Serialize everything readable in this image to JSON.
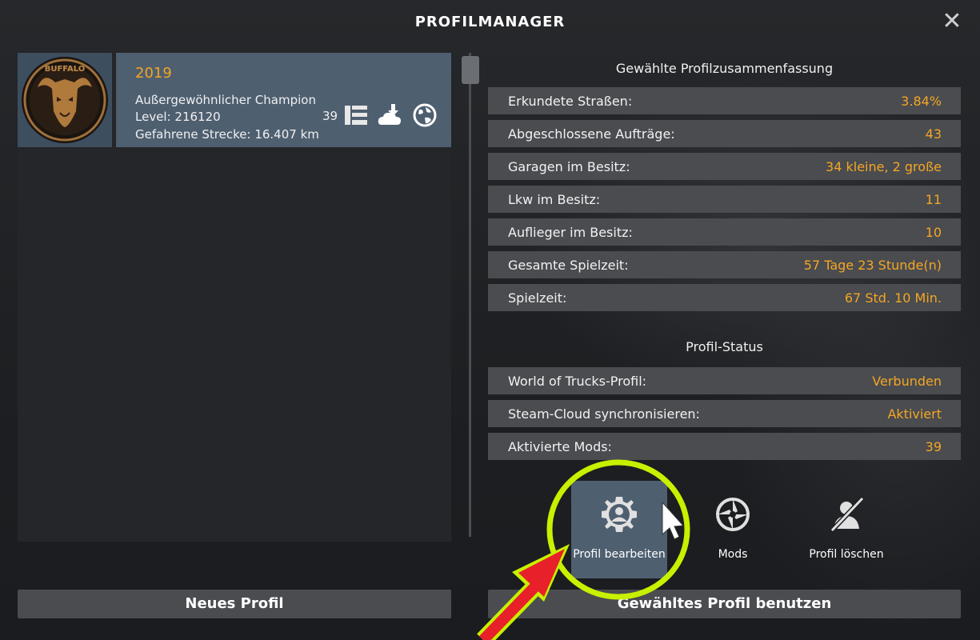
{
  "window": {
    "title": "PROFILMANAGER",
    "close_icon": "close-icon"
  },
  "profile": {
    "name": "2019",
    "title": "Außergewöhnlicher Champion",
    "level": "Level: 216120",
    "distance": "Gefahrene Strecke: 16.407 km",
    "mods_count": "39",
    "icons": [
      "mods-list-icon",
      "cloud-download-icon",
      "globe-icon"
    ],
    "avatar": {
      "text": "BUFFALO",
      "icon": "buffalo-skull-logo"
    }
  },
  "summary": {
    "title": "Gewählte Profilzusammenfassung",
    "rows": [
      {
        "label": "Erkundete Straßen:",
        "value": "3.84%"
      },
      {
        "label": "Abgeschlossene Aufträge:",
        "value": "43"
      },
      {
        "label": "Garagen im Besitz:",
        "value": "34 kleine, 2 große"
      },
      {
        "label": "Lkw im Besitz:",
        "value": "11"
      },
      {
        "label": "Auflieger im Besitz:",
        "value": "10"
      },
      {
        "label": "Gesamte Spielzeit:",
        "value": "57 Tage 23 Stunde(n)"
      },
      {
        "label": "Spielzeit:",
        "value": "67 Std. 10 Min."
      }
    ]
  },
  "status": {
    "title": "Profil-Status",
    "rows": [
      {
        "label": "World of Trucks-Profil:",
        "value": "Verbunden"
      },
      {
        "label": "Steam-Cloud synchronisieren:",
        "value": "Aktiviert"
      },
      {
        "label": "Aktivierte Mods:",
        "value": "39"
      }
    ]
  },
  "actions": [
    {
      "label": "Profil bearbeiten",
      "icon": "gear-person-icon"
    },
    {
      "label": "Mods",
      "icon": "mods-icon"
    },
    {
      "label": "Profil löschen",
      "icon": "delete-profile-icon"
    }
  ],
  "buttons": {
    "new_profile": "Neues Profil",
    "use_profile": "Gewähltes Profil benutzen"
  },
  "colors": {
    "accent": "#f5a623",
    "highlight_circle": "#c8f000",
    "arrow": "#e8202a"
  }
}
